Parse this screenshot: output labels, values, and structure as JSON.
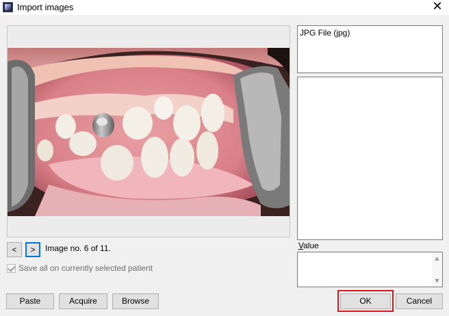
{
  "window": {
    "title": "Import images",
    "close_glyph": "✕",
    "app_icon": "app-logo-icon"
  },
  "file_types": {
    "items": [
      "JPG File (jpg)"
    ]
  },
  "navigation": {
    "prev_label": "<",
    "next_label": ">",
    "counter_text": "Image no. 6 of 11."
  },
  "options": {
    "save_all_label": "Save all on currently selected patient",
    "save_all_checked": true,
    "save_all_disabled": true
  },
  "value": {
    "label_accel": "V",
    "label_rest": "alue",
    "text": ""
  },
  "buttons": {
    "paste": "Paste",
    "acquire": "Acquire",
    "browse": "Browse",
    "ok": "OK",
    "cancel": "Cancel"
  },
  "colors": {
    "highlight": "#d9141a",
    "focus": "#0078d7"
  }
}
